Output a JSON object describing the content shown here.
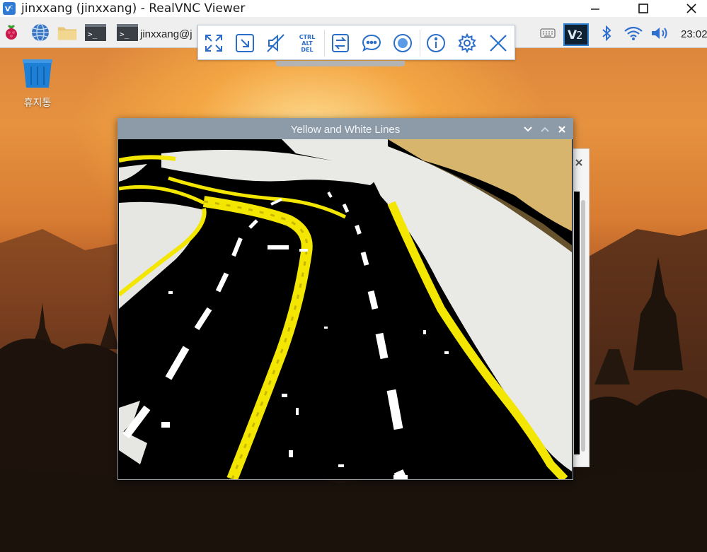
{
  "host_window": {
    "title": "jinxxang (jinxxang) - RealVNC Viewer",
    "icons": {
      "app": "realvnc-icon",
      "minimize": "minimize-icon",
      "maximize": "maximize-icon",
      "close": "close-icon"
    }
  },
  "taskbar": {
    "terminal_label": "jinxxang@j",
    "clock": "23:02",
    "icons": [
      "raspberry-menu-icon",
      "web-browser-icon",
      "file-manager-icon",
      "terminal-icon",
      "terminal-icon"
    ],
    "tray_icons": [
      "keyboard-icon",
      "vnc-server-icon",
      "bluetooth-icon",
      "wifi-icon",
      "volume-icon"
    ]
  },
  "vnc_toolbar": {
    "ctrl_alt_del_lines": [
      "CTRL",
      "ALT",
      "DEL"
    ],
    "buttons": [
      "fullscreen-icon",
      "scale-icon",
      "audio-muted-icon",
      "ctrl-alt-del-icon",
      "file-transfer-icon",
      "chat-icon",
      "record-icon",
      "info-icon",
      "settings-icon",
      "close-icon"
    ]
  },
  "desktop": {
    "trash_label": "휴지통"
  },
  "app_window": {
    "title": "Yellow and White Lines",
    "controls": [
      "minimize-chevron-icon",
      "maximize-chevron-icon",
      "close-x-icon"
    ]
  },
  "colors": {
    "lane_yellow": "#f3e600",
    "toolbar_accent": "#2b6ec9",
    "window_titlebar": "#8d9aa8"
  }
}
